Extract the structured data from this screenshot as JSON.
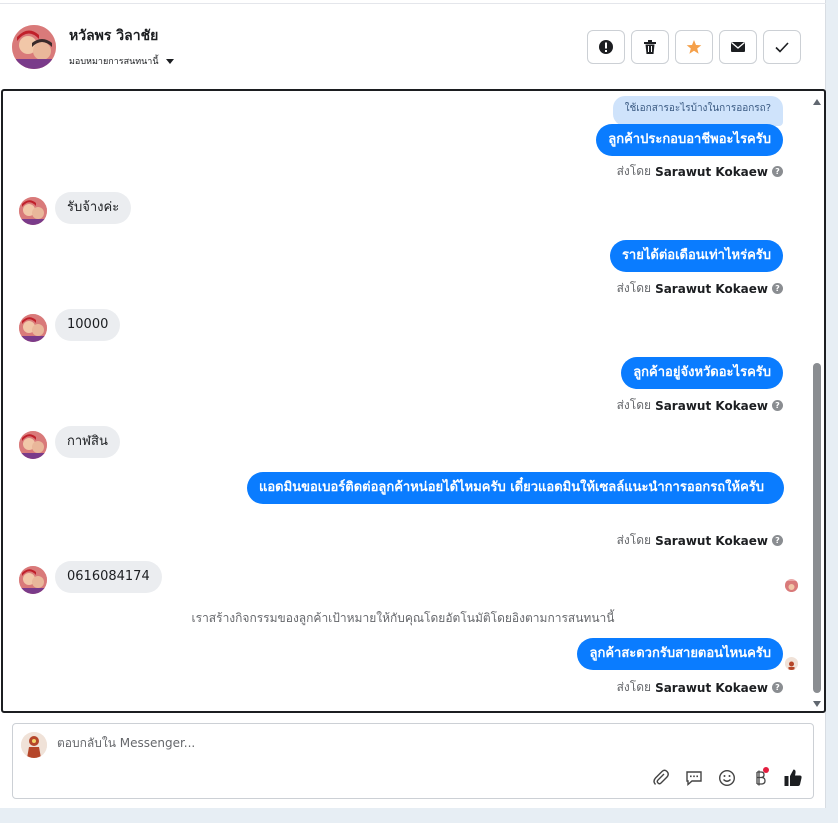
{
  "header": {
    "contact_name": "หวัลพร วิลาชัย",
    "assign_label": "มอบหมายการสนทนานี้",
    "actions": [
      {
        "name": "report-button",
        "icon": "exclamation-icon"
      },
      {
        "name": "delete-button",
        "icon": "trash-icon"
      },
      {
        "name": "star-button",
        "icon": "star-icon"
      },
      {
        "name": "mark-unread-button",
        "icon": "envelope-icon"
      },
      {
        "name": "mark-done-button",
        "icon": "check-icon"
      }
    ]
  },
  "conversation": {
    "faded_preview": "ใช้เอกสารอะไรบ้างในการออกรถ?",
    "sender_prefix": "ส่งโดย",
    "sender_name": "Sarawut Kokaew",
    "messages": [
      {
        "dir": "out",
        "text": "ลูกค้าประกอบอาชีพอะไรครับ"
      },
      {
        "dir": "in",
        "text": "รับจ้างค่ะ"
      },
      {
        "dir": "out",
        "text": "รายได้ต่อเดือนเท่าไหร่ครับ"
      },
      {
        "dir": "in",
        "text": "10000"
      },
      {
        "dir": "out",
        "text": "ลูกค้าอยู่จังหวัดอะไรครับ"
      },
      {
        "dir": "in",
        "text": "กาฬสิน"
      },
      {
        "dir": "out",
        "text": "แอดมินขอเบอร์ติดต่อลูกค้าหน่อยได้ไหมครับ เดี๋ยวแอดมินให้เซลล์แนะนำการออกรถให้ครับ"
      },
      {
        "dir": "in",
        "text": "0616084174"
      },
      {
        "dir": "out",
        "text": "ลูกค้าสะดวกรับสายตอนไหนครับ"
      }
    ],
    "system_note": "เราสร้างกิจกรรมของลูกค้าเป้าหมายให้กับคุณโดยอัตโนมัติโดยอิงตามการสนทนานี้"
  },
  "composer": {
    "placeholder": "ตอบกลับใน Messenger...",
    "tools": [
      "paperclip-icon",
      "quick-reply-icon",
      "emoji-icon",
      "baht-icon",
      "like-icon"
    ]
  },
  "colors": {
    "outgoing_bubble": "#0a7cff",
    "incoming_bubble": "#ebedf0",
    "star": "#f5a04a"
  }
}
